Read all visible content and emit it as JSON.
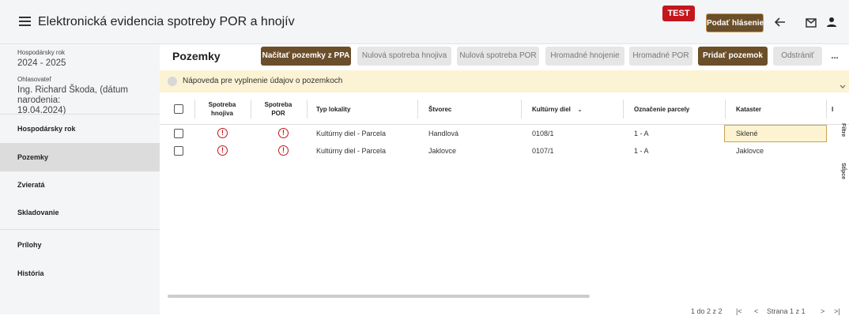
{
  "header": {
    "title": "Elektronická evidencia spotreby POR a hnojív",
    "test_badge": "TEST",
    "report_button": "Podať hlásenie"
  },
  "sidebar": {
    "year_label": "Hospodársky rok",
    "year_value": "2024 - 2025",
    "reporter_label": "Ohlasovateľ",
    "reporter_value_1": "Ing. Richard Škoda, (dátum narodenia:",
    "reporter_value_2": "19.04.2024)",
    "items": [
      {
        "label": "Hospodársky rok"
      },
      {
        "label": "Pozemky"
      },
      {
        "label": "Zvieratá"
      },
      {
        "label": "Skladovanie"
      },
      {
        "label": "Prílohy"
      },
      {
        "label": "História"
      }
    ]
  },
  "main": {
    "title": "Pozemky",
    "actions": [
      {
        "label": "Načítať pozemky z PPA"
      },
      {
        "label": "Nulová spotreba hnojiva"
      },
      {
        "label": "Nulová spotreba POR"
      },
      {
        "label": "Hromadné hnojenie"
      },
      {
        "label": "Hromadné POR"
      },
      {
        "label": "Pridať pozemok"
      },
      {
        "label": "Odstrániť"
      },
      {
        "label": "..."
      }
    ],
    "help_text": "Nápoveda pre vyplnenie údajov o pozemkoch"
  },
  "table": {
    "headers": {
      "hnojiva_1": "Spotreba",
      "hnojiva_2": "hnojiva",
      "por_1": "Spotreba",
      "por_2": "POR",
      "typ": "Typ lokality",
      "stvorec": "Štvorec",
      "diel": "Kultúrny diel",
      "parcela": "Označenie parcely",
      "kataster": "Kataster"
    },
    "rows": [
      {
        "typ": "Kultúrny diel - Parcela",
        "stvorec": "Handlová",
        "diel": "0108/1",
        "parcela": "1 - A",
        "kataster": "Sklené"
      },
      {
        "typ": "Kultúrny diel - Parcela",
        "stvorec": "Jaklovce",
        "diel": "0107/1",
        "parcela": "1 - A",
        "kataster": "Jaklovce"
      }
    ]
  },
  "footer": {
    "range": "1 do 2 z 2",
    "page": "Strana",
    "page_num": "1",
    "of": "z",
    "total": "1"
  },
  "side_tabs": {
    "filters": "Filtre",
    "columns": "Stĺpce"
  },
  "colors": {
    "brand": "#6b4e2a",
    "danger": "#c4171d",
    "help_bg": "#fbf3d3"
  }
}
